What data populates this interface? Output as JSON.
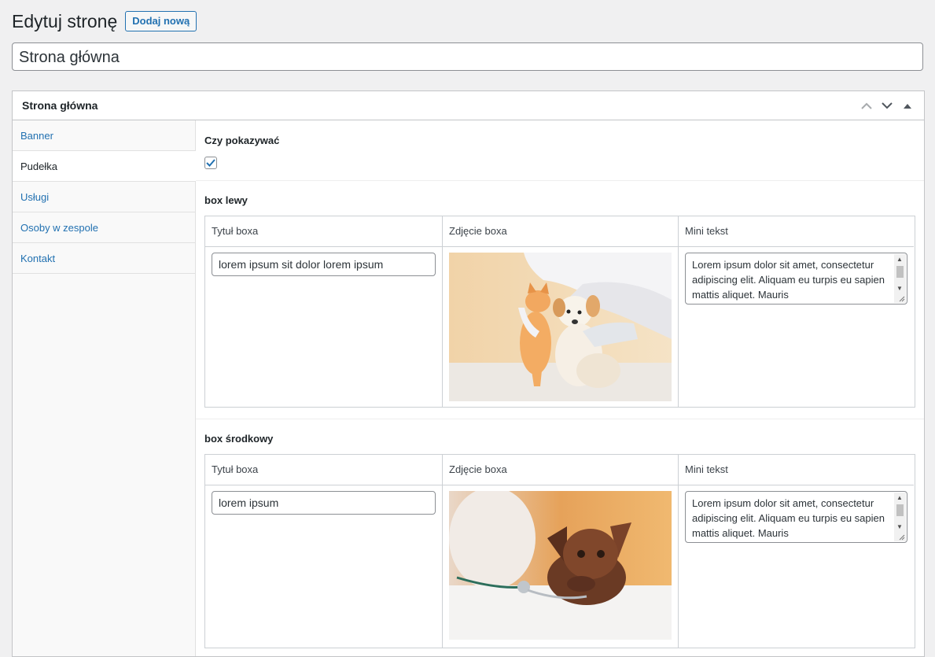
{
  "page": {
    "title": "Edytuj stronę",
    "add_new_label": "Dodaj nową",
    "post_title_value": "Strona główna"
  },
  "metabox": {
    "title": "Strona główna",
    "tabs": [
      {
        "label": "Banner"
      },
      {
        "label": "Pudełka",
        "active": true
      },
      {
        "label": "Usługi"
      },
      {
        "label": "Osoby w zespole"
      },
      {
        "label": "Kontakt"
      }
    ],
    "show_field": {
      "label": "Czy pokazywać",
      "checked": true
    },
    "columns": {
      "title": "Tytuł boxa",
      "photo": "Zdjęcie boxa",
      "text": "Mini tekst"
    },
    "groups": [
      {
        "label": "box lewy",
        "title_value": "lorem ipsum sit dolor lorem ipsum",
        "photo": "kitten-and-puppy-photo",
        "text_value": "Lorem ipsum dolor sit amet, consectetur adipiscing elit. Aliquam eu turpis eu sapien mattis aliquet. Mauris"
      },
      {
        "label": "box środkowy",
        "title_value": "lorem ipsum",
        "photo": "puppy-with-stethoscope-photo",
        "text_value": "Lorem ipsum dolor sit amet, consectetur adipiscing elit. Aliquam eu turpis eu sapien mattis aliquet. Mauris"
      }
    ]
  },
  "colors": {
    "accent": "#2271b1",
    "border": "#c3c4c7",
    "background": "#f0f0f1"
  }
}
